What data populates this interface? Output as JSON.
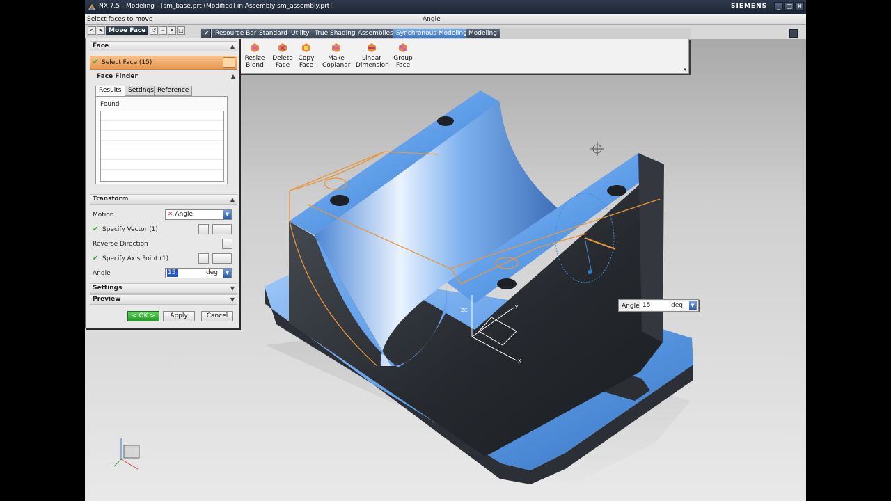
{
  "window": {
    "title": "NX 7.5 - Modeling - [sm_base.prt (Modified)  in Assembly sm_assembly.prt]",
    "brand": "SIEMENS",
    "minimize": "_",
    "maximize": "□",
    "close": "X"
  },
  "cue_line": {
    "prompt": "Select faces to move",
    "status": "Angle"
  },
  "dialog_toolbar": {
    "title": "Move Face",
    "back": "<",
    "pin": "⬉",
    "reset": "↺",
    "minimize": "–",
    "close": "✕",
    "restore": "□"
  },
  "resource_tabs": [
    "Resource Bar",
    "Standard",
    "Utility",
    "True Shading",
    "Assemblies",
    "Synchronous Modeling",
    "Modeling"
  ],
  "active_tab": "Synchronous Modeling",
  "ribbon": {
    "buttons": [
      {
        "line1": "Resize",
        "line2": "Blend",
        "icon": "resize-blend-icon"
      },
      {
        "line1": "Delete",
        "line2": "Face",
        "icon": "delete-face-icon"
      },
      {
        "line1": "Copy",
        "line2": "Face",
        "icon": "copy-face-icon"
      },
      {
        "line1": "Make",
        "line2": "Coplanar",
        "icon": "make-coplanar-icon"
      },
      {
        "line1": "Linear",
        "line2": "Dimension",
        "icon": "linear-dimension-icon"
      },
      {
        "line1": "Group",
        "line2": "Face",
        "icon": "group-face-icon"
      }
    ]
  },
  "dialog": {
    "face_section": "Face",
    "select_face_label": "Select Face (15)",
    "face_finder": "Face Finder",
    "inner_tabs": [
      "Results",
      "Settings",
      "Reference"
    ],
    "active_inner_tab": "Results",
    "found_label": "Found",
    "transform_section": "Transform",
    "motion_label": "Motion",
    "motion_value": "Angle",
    "specify_vector": "Specify Vector (1)",
    "reverse_direction": "Reverse Direction",
    "specify_axis_point": "Specify Axis Point (1)",
    "angle_label": "Angle",
    "angle_value": "15",
    "angle_unit": "deg",
    "settings_section": "Settings",
    "preview_section": "Preview",
    "ok_label": "< OK >",
    "apply_label": "Apply",
    "cancel_label": "Cancel"
  },
  "viewport": {
    "angle_popup_label": "Angle",
    "angle_popup_value": "15",
    "angle_popup_unit": "deg",
    "axis_labels": {
      "x": "X",
      "y": "Y",
      "z": "ZC"
    },
    "accent_color": "#e8963a",
    "face_color": "#5b9be6"
  }
}
